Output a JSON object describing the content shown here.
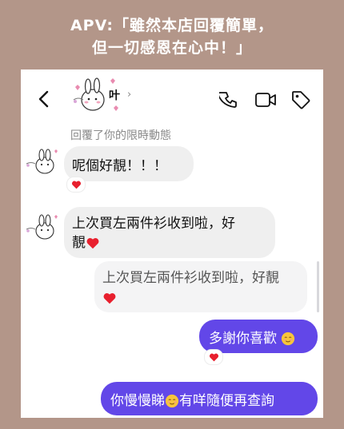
{
  "banner": {
    "line1": "APV:「雖然本店回覆簡單，",
    "line2": "但一切感恩在心中！」"
  },
  "header": {
    "contact_name": "叶",
    "chevron": "›",
    "icons": [
      "chevron-left-icon",
      "phone-icon",
      "video-camera-icon",
      "tag-icon"
    ]
  },
  "messages": {
    "replied_story_label": "回覆了你的限時動態",
    "msg1": "呢個好靚！！！",
    "msg2_line1": "上次買左兩件衫收到啦，好",
    "msg2_line2": "靚",
    "quoted_line1": "上次買左兩件衫收到啦，好靚",
    "msg3": "多謝你喜歡",
    "msg4": "你慢慢睇",
    "msg4_tail": "有咩隨便再查詢"
  },
  "colors": {
    "background": "#b39689",
    "sent_bubble": "#6247e8",
    "received_bubble": "#efefef",
    "heart": "#e8202e"
  }
}
